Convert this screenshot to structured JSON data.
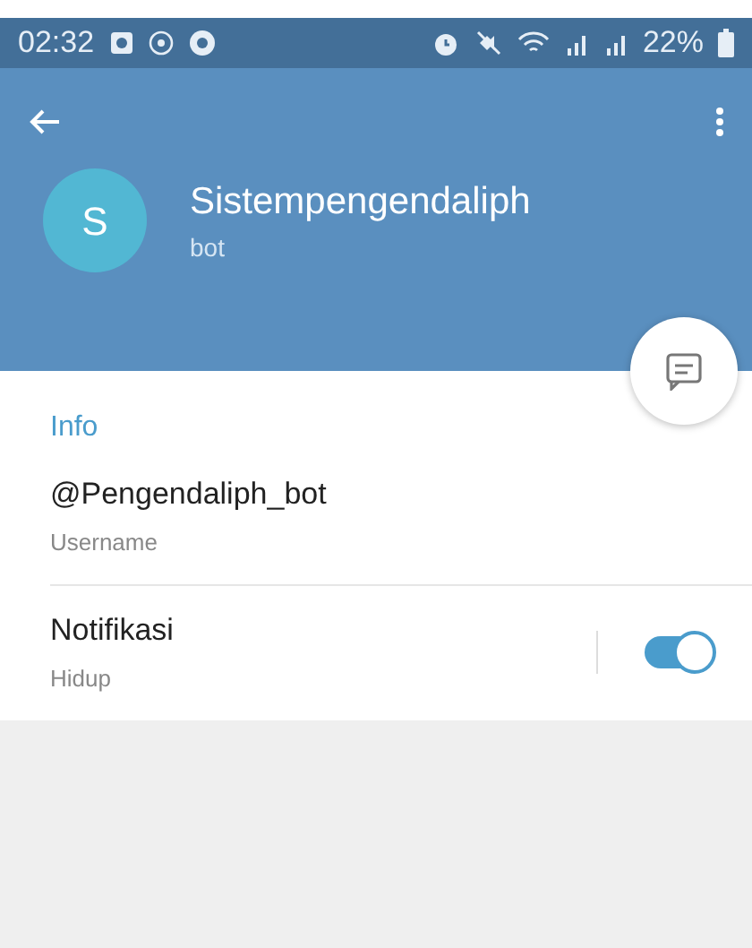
{
  "status_bar": {
    "time": "02:32",
    "battery": "22%"
  },
  "header": {
    "avatar_letter": "S",
    "name": "Sistempengendaliph",
    "subtitle": "bot"
  },
  "info": {
    "heading": "Info",
    "rows": [
      {
        "kind": "text",
        "title": "@Pengendaliph_bot",
        "subtitle": "Username"
      },
      {
        "kind": "toggle",
        "title": "Notifikasi",
        "subtitle": "Hidup",
        "on": true
      }
    ]
  }
}
